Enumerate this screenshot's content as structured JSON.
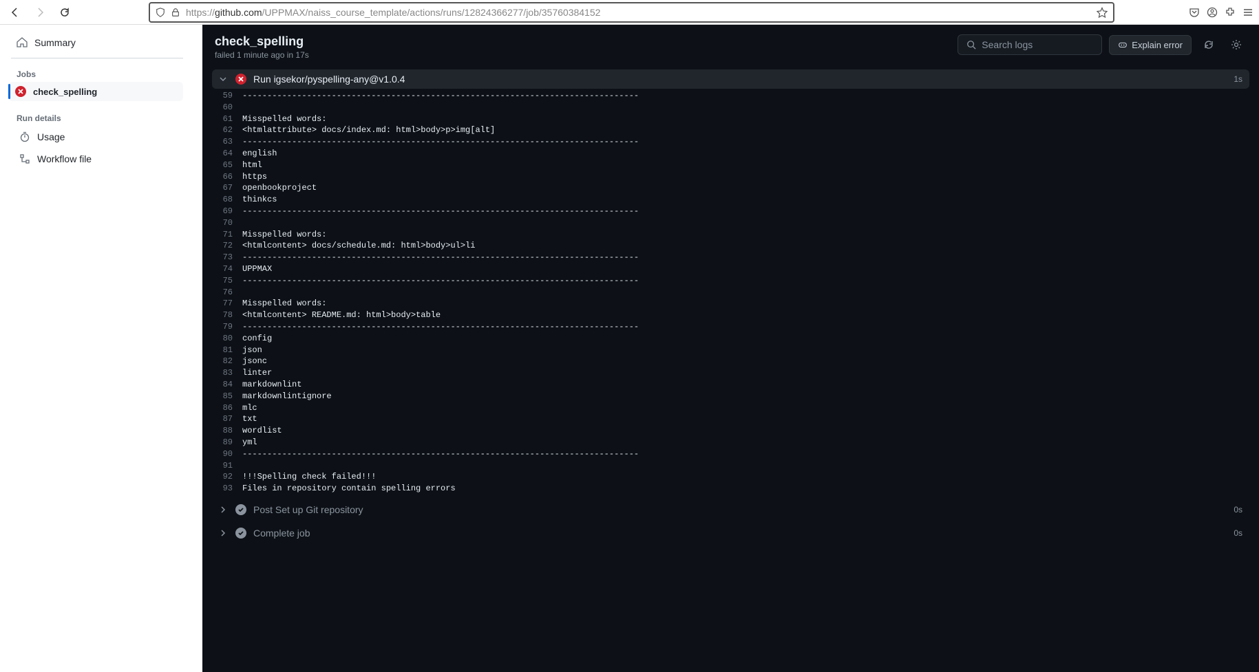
{
  "browser": {
    "url_prefix": "https://",
    "url_host": "github.com",
    "url_path": "/UPPMAX/naiss_course_template/actions/runs/12824366277/job/35760384152"
  },
  "sidebar": {
    "summary": "Summary",
    "jobs_label": "Jobs",
    "job_name": "check_spelling",
    "run_details_label": "Run details",
    "usage": "Usage",
    "workflow_file": "Workflow file"
  },
  "job": {
    "title": "check_spelling",
    "status_line": "failed 1 minute ago in 17s",
    "search_placeholder": "Search logs",
    "explain_label": "Explain error"
  },
  "steps": {
    "expanded": {
      "label": "Run igsekor/pyspelling-any@v1.0.4",
      "time": "1s"
    },
    "post_setup": {
      "label": "Post Set up Git repository",
      "time": "0s"
    },
    "complete": {
      "label": "Complete job",
      "time": "0s"
    }
  },
  "log_lines": [
    {
      "n": 59,
      "t": "--------------------------------------------------------------------------------"
    },
    {
      "n": 60,
      "t": ""
    },
    {
      "n": 61,
      "t": "Misspelled words:"
    },
    {
      "n": 62,
      "t": "<htmlattribute> docs/index.md: html>body>p>img[alt]"
    },
    {
      "n": 63,
      "t": "--------------------------------------------------------------------------------"
    },
    {
      "n": 64,
      "t": "english"
    },
    {
      "n": 65,
      "t": "html"
    },
    {
      "n": 66,
      "t": "https"
    },
    {
      "n": 67,
      "t": "openbookproject"
    },
    {
      "n": 68,
      "t": "thinkcs"
    },
    {
      "n": 69,
      "t": "--------------------------------------------------------------------------------"
    },
    {
      "n": 70,
      "t": ""
    },
    {
      "n": 71,
      "t": "Misspelled words:"
    },
    {
      "n": 72,
      "t": "<htmlcontent> docs/schedule.md: html>body>ul>li"
    },
    {
      "n": 73,
      "t": "--------------------------------------------------------------------------------"
    },
    {
      "n": 74,
      "t": "UPPMAX"
    },
    {
      "n": 75,
      "t": "--------------------------------------------------------------------------------"
    },
    {
      "n": 76,
      "t": ""
    },
    {
      "n": 77,
      "t": "Misspelled words:"
    },
    {
      "n": 78,
      "t": "<htmlcontent> README.md: html>body>table"
    },
    {
      "n": 79,
      "t": "--------------------------------------------------------------------------------"
    },
    {
      "n": 80,
      "t": "config"
    },
    {
      "n": 81,
      "t": "json"
    },
    {
      "n": 82,
      "t": "jsonc"
    },
    {
      "n": 83,
      "t": "linter"
    },
    {
      "n": 84,
      "t": "markdownlint"
    },
    {
      "n": 85,
      "t": "markdownlintignore"
    },
    {
      "n": 86,
      "t": "mlc"
    },
    {
      "n": 87,
      "t": "txt"
    },
    {
      "n": 88,
      "t": "wordlist"
    },
    {
      "n": 89,
      "t": "yml"
    },
    {
      "n": 90,
      "t": "--------------------------------------------------------------------------------"
    },
    {
      "n": 91,
      "t": ""
    },
    {
      "n": 92,
      "t": "!!!Spelling check failed!!!"
    },
    {
      "n": 93,
      "t": "Files in repository contain spelling errors"
    }
  ]
}
